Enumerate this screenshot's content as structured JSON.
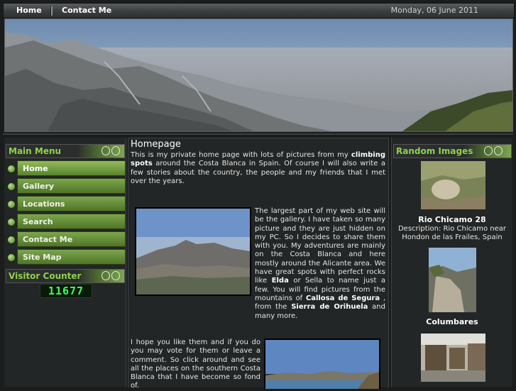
{
  "nav": {
    "home": "Home",
    "contact": "Contact Me",
    "date": "Monday, 06 June 2011"
  },
  "main_menu": {
    "title": "Main Menu",
    "items": [
      "Home",
      "Gallery",
      "Locations",
      "Search",
      "Contact Me",
      "Site Map"
    ]
  },
  "visitor": {
    "title": "Visitor Counter",
    "count": "11677"
  },
  "content": {
    "title": "Homepage",
    "p1_a": "This is my private home page with lots of pictures from my ",
    "p1_b": "climbing spots",
    "p1_c": " around the Costa Blanca in Spain.  Of course I will also write a few stories about the country, the people and my friends that I met over the years.",
    "p2_a": "The largest part of my web site will be the gallery. I have taken so many picture and they are just hidden on my PC. So I decides to share them with you. My adventures are mainly on the Costa Blanca and here mostly around the Alicante area. We have great spots with perfect rocks like ",
    "p2_b": "Elda",
    "p2_c": " or Sella to name just a few. You will find pictures from the mountains of ",
    "p2_d": "Callosa de Segura",
    "p2_e": " , from the ",
    "p2_f": "Sierra de Orihuela",
    "p2_g": " and many more.",
    "p3": "I hope you like them and if you do you may vote for them or leave a comment. So click around and see all the places on the southern Costa Blanca that I have become so fond of."
  },
  "random": {
    "title": "Random Images",
    "img1_title": "Rio Chicamo 28",
    "img1_desc": "Description: Rio Chicamo near Hondon de las Frailes, Spain",
    "img2_title": "Columbares"
  }
}
